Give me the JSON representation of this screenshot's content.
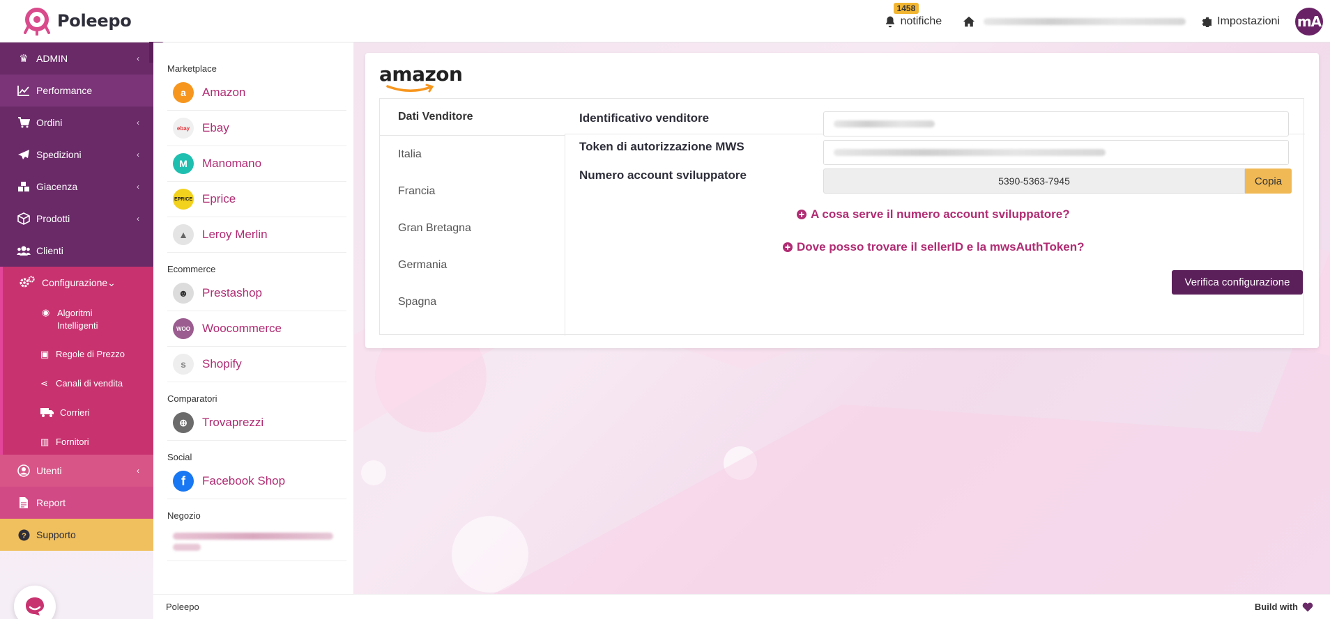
{
  "header": {
    "app_name": "Poleepo",
    "notifications_count": "1458",
    "notifications_label": "notifiche",
    "settings_label": "Impostazioni",
    "avatar_initials": "mA"
  },
  "sidebar": {
    "collapse_icon": "chevron-left-icon",
    "items": [
      {
        "label": "ADMIN",
        "icon": "crown-icon"
      },
      {
        "label": "Performance",
        "icon": "chart-line-icon"
      },
      {
        "label": "Ordini",
        "icon": "cart-icon"
      },
      {
        "label": "Spedizioni",
        "icon": "paper-plane-icon"
      },
      {
        "label": "Giacenza",
        "icon": "boxes-icon"
      },
      {
        "label": "Prodotti",
        "icon": "cube-icon"
      },
      {
        "label": "Clienti",
        "icon": "users-icon"
      }
    ],
    "config": {
      "label": "Configurazione",
      "subitems": [
        {
          "label": "Algoritmi Intelligenti"
        },
        {
          "label": "Regole di Prezzo"
        },
        {
          "label": "Canali di vendita"
        },
        {
          "label": "Corrieri"
        },
        {
          "label": "Fornitori"
        }
      ]
    },
    "utenti_label": "Utenti",
    "report_label": "Report",
    "supporto_label": "Supporto"
  },
  "channels": {
    "groups": [
      {
        "title": "Marketplace",
        "items": [
          "Amazon",
          "Ebay",
          "Manomano",
          "Eprice",
          "Leroy Merlin"
        ]
      },
      {
        "title": "Ecommerce",
        "items": [
          "Prestashop",
          "Woocommerce",
          "Shopify"
        ]
      },
      {
        "title": "Comparatori",
        "items": [
          "Trovaprezzi"
        ]
      },
      {
        "title": "Social",
        "items": [
          "Facebook Shop"
        ]
      },
      {
        "title": "Negozio",
        "items": []
      }
    ]
  },
  "card": {
    "brand": "amazon",
    "tabs": [
      "Dati Venditore",
      "Italia",
      "Francia",
      "Gran Bretagna",
      "Germania",
      "Spagna"
    ],
    "fields": {
      "seller_id_label": "Identificativo venditore",
      "mws_token_label": "Token di autorizzazione MWS",
      "dev_account_label": "Numero account sviluppatore",
      "dev_account_value": "5390-5363-7945",
      "copy_label": "Copia"
    },
    "help_links": {
      "dev_account_help": "A cosa serve il numero account sviluppatore?",
      "seller_id_help": "Dove posso trovare il sellerID e la mwsAuthToken?"
    },
    "verify_label": "Verifica configurazione"
  },
  "footer": {
    "left": "Poleepo",
    "right": "Build with"
  },
  "colors": {
    "primary": "#5b1f5a",
    "accent": "#b02c73",
    "warning": "#f0b955"
  }
}
